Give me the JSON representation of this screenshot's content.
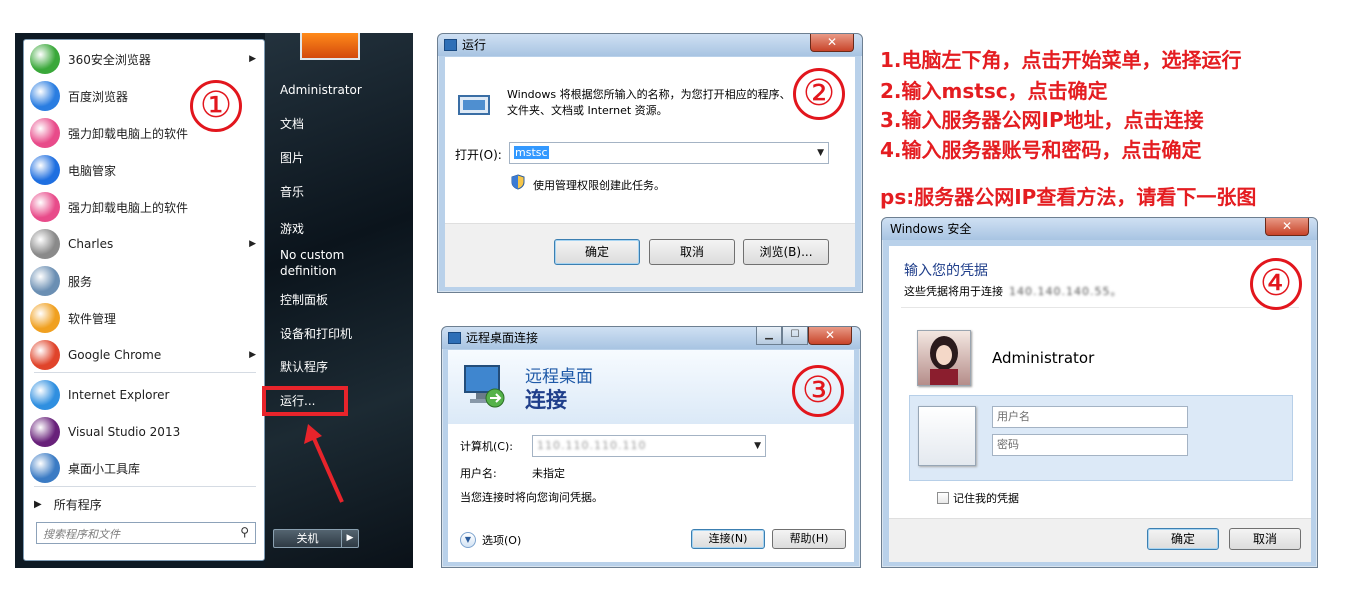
{
  "start_menu": {
    "programs": [
      {
        "label": "360安全浏览器",
        "icon": "360-browser-icon",
        "color": "#3aa83a",
        "has_arrow": true
      },
      {
        "label": "百度浏览器",
        "icon": "baidu-browser-icon",
        "color": "#2a7de1",
        "has_arrow": false
      },
      {
        "label": "强力卸载电脑上的软件",
        "icon": "uninstall-icon",
        "color": "#e84b8a",
        "has_arrow": false
      },
      {
        "label": "电脑管家",
        "icon": "pc-manager-icon",
        "color": "#1f6fe0",
        "has_arrow": false
      },
      {
        "label": "强力卸载电脑上的软件",
        "icon": "uninstall-icon",
        "color": "#e84b8a",
        "has_arrow": false
      },
      {
        "label": "Charles",
        "icon": "charles-icon",
        "color": "#8a8a8a",
        "has_arrow": true
      },
      {
        "label": "服务",
        "icon": "services-gear-icon",
        "color": "#6b8fb3",
        "has_arrow": false
      },
      {
        "label": "软件管理",
        "icon": "software-manager-icon",
        "color": "#f0a020",
        "has_arrow": false
      },
      {
        "label": "Google Chrome",
        "icon": "chrome-icon",
        "color": "#e0442b",
        "has_arrow": true
      },
      {
        "label": "Internet Explorer",
        "icon": "ie-icon",
        "color": "#2f8fe0",
        "has_arrow": false
      },
      {
        "label": "Visual Studio 2013",
        "icon": "visual-studio-icon",
        "color": "#68217a",
        "has_arrow": false
      },
      {
        "label": "桌面小工具库",
        "icon": "desktop-gadgets-icon",
        "color": "#3b7bc4",
        "has_arrow": false
      }
    ],
    "all_programs": "所有程序",
    "search_placeholder": "搜索程序和文件",
    "right_items": [
      "Administrator",
      "文档",
      "图片",
      "音乐",
      "游戏",
      "No custom definition",
      "控制面板",
      "设备和打印机",
      "默认程序",
      "运行..."
    ],
    "shutdown": "关机"
  },
  "step_badges": [
    "①",
    "②",
    "③",
    "④"
  ],
  "run_dialog": {
    "title": "运行",
    "description_line1": "Windows 将根据您所输入的名称，为您打开相应的程序、",
    "description_line2": "文件夹、文档或 Internet 资源。",
    "open_label": "打开(O):",
    "open_value": "mstsc",
    "admin_note": "使用管理权限创建此任务。",
    "ok": "确定",
    "cancel": "取消",
    "browse": "浏览(B)..."
  },
  "rdp_dialog": {
    "title": "远程桌面连接",
    "header_line1": "远程桌面",
    "header_line2": "连接",
    "computer_label": "计算机(C):",
    "computer_value": "110.110.110.110",
    "username_label": "用户名:",
    "username_value": "未指定",
    "prompt_text": "当您连接时将向您询问凭据。",
    "options": "选项(O)",
    "connect": "连接(N)",
    "help": "帮助(H)"
  },
  "instructions": [
    "1.电脑左下角，点击开始菜单，选择运行",
    "2.输入mstsc，点击确定",
    "3.输入服务器公网IP地址，点击连接",
    "4.输入服务器账号和密码，点击确定"
  ],
  "ps_note": "ps:服务器公网IP查看方法，请看下一张图",
  "security_dialog": {
    "title": "Windows 安全",
    "heading": "输入您的凭据",
    "subtext": "这些凭据将用于连接",
    "subtext_ip": "140.140.140.55。",
    "account_name": "Administrator",
    "username_placeholder": "用户名",
    "password_placeholder": "密码",
    "remember": "记住我的凭据",
    "ok": "确定",
    "cancel": "取消"
  },
  "colors": {
    "accent_red": "#e41d21",
    "titlebar_blue": "#b9d1ea",
    "link_blue": "#1f3e8a"
  }
}
